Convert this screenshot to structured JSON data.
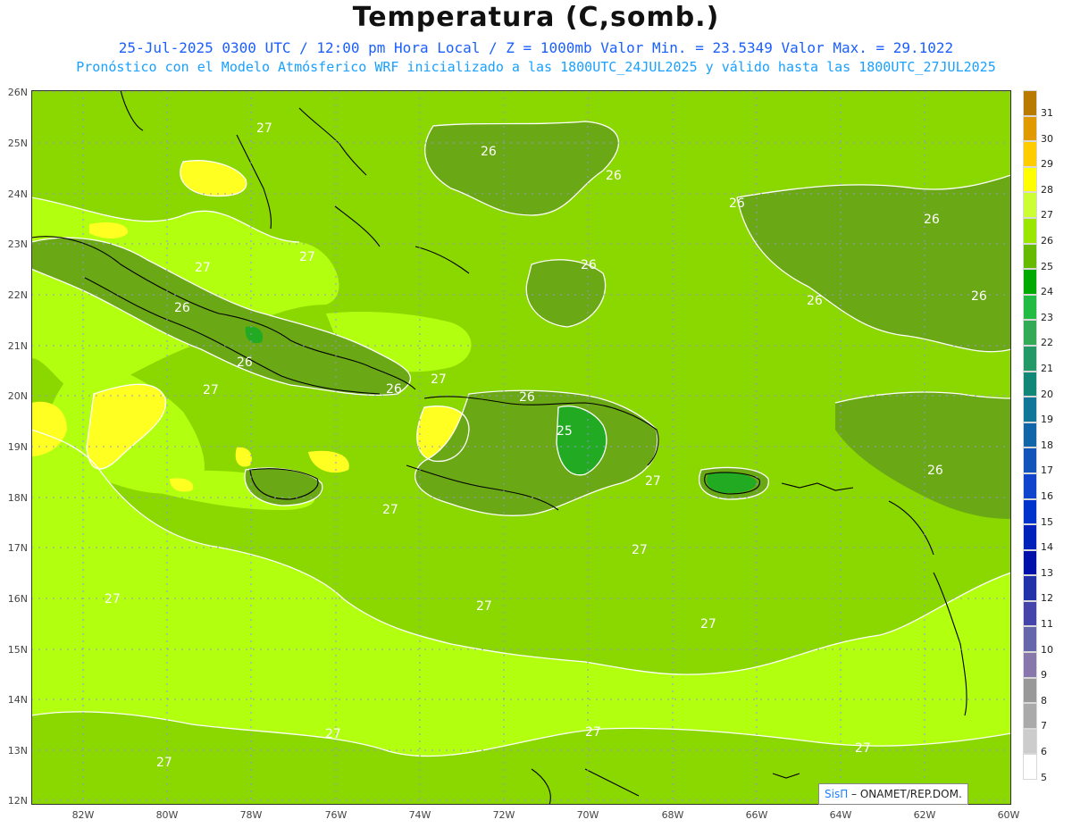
{
  "title": "Temperatura (C,somb.)",
  "subtitle1": "25-Jul-2025 0300 UTC / 12:00 pm Hora Local / Z = 1000mb  Valor Min. = 23.5349  Valor Max. = 29.1022",
  "subtitle2": "Pronóstico con el Modelo Atmósferico WRF inicializado a las 1800UTC_24JUL2025 y válido hasta las  1800UTC_27JUL2025",
  "credit": {
    "brand": "SisΠ",
    "text": " – ONAMET/REP.DOM."
  },
  "lat_labels": [
    "26N",
    "25N",
    "24N",
    "23N",
    "22N",
    "21N",
    "20N",
    "19N",
    "18N",
    "17N",
    "16N",
    "15N",
    "14N",
    "13N",
    "12N"
  ],
  "lon_labels": [
    "82W",
    "80W",
    "78W",
    "76W",
    "74W",
    "72W",
    "70W",
    "68W",
    "66W",
    "64W",
    "62W",
    "60W"
  ],
  "contour_labels": [
    {
      "text": "27"
    },
    {
      "text": "26"
    },
    {
      "text": "26"
    },
    {
      "text": "26"
    },
    {
      "text": "26"
    },
    {
      "text": "26"
    },
    {
      "text": "27"
    },
    {
      "text": "27"
    },
    {
      "text": "26"
    },
    {
      "text": "26"
    },
    {
      "text": "26"
    },
    {
      "text": "26"
    },
    {
      "text": "27"
    },
    {
      "text": "26"
    },
    {
      "text": "27"
    },
    {
      "text": "26"
    },
    {
      "text": "25"
    },
    {
      "text": "26"
    },
    {
      "text": "27"
    },
    {
      "text": "27"
    },
    {
      "text": "27"
    },
    {
      "text": "27"
    },
    {
      "text": "27"
    },
    {
      "text": "27"
    },
    {
      "text": "27"
    },
    {
      "text": "27"
    },
    {
      "text": "27"
    },
    {
      "text": "27"
    }
  ],
  "colorbar": {
    "values": [
      "31",
      "30",
      "29",
      "28",
      "27",
      "26",
      "25",
      "24",
      "23",
      "22",
      "21",
      "20",
      "19",
      "18",
      "17",
      "16",
      "15",
      "14",
      "13",
      "12",
      "11",
      "10",
      "9",
      "8",
      "7",
      "6",
      "5"
    ],
    "colors": [
      "#b87a00",
      "#e09a00",
      "#ffcc00",
      "#ffff00",
      "#ccff33",
      "#99e600",
      "#66bb00",
      "#00aa00",
      "#22bb44",
      "#33aa55",
      "#229966",
      "#118877",
      "#117799",
      "#1166aa",
      "#1155bb",
      "#1144cc",
      "#0033cc",
      "#0022bb",
      "#0011aa",
      "#2233aa",
      "#4444aa",
      "#6666aa",
      "#8877aa",
      "#999999",
      "#aaaaaa",
      "#cccccc",
      "#ffffff"
    ]
  },
  "field_colors": {
    "t25": "#22aa22",
    "t26": "#6aa815",
    "t27": "#8bd800",
    "t28": "#b2ff10",
    "t29": "#ffff22",
    "land": "#000000",
    "contour": "#ffffff"
  }
}
